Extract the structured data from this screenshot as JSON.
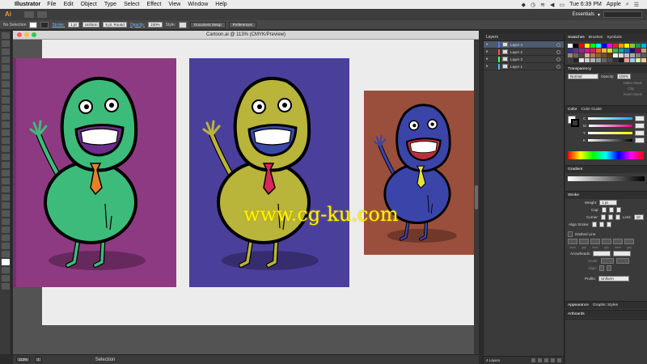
{
  "menubar": {
    "apple_glyph": "",
    "app_name": "Illustrator",
    "items": [
      "File",
      "Edit",
      "Object",
      "Type",
      "Select",
      "Effect",
      "View",
      "Window",
      "Help"
    ],
    "clock": "Tue 6:39 PM",
    "user": "Apple"
  },
  "appbar": {
    "logo": "Ai",
    "workspace": "Essentials"
  },
  "controlbar": {
    "selection_status": "No Selection",
    "stroke_label": "Stroke:",
    "stroke_weight": "1 pt",
    "profile": "Uniform",
    "brush": "5 pt. Round",
    "opacity_label": "Opacity:",
    "opacity_value": "100%",
    "style_label": "Style:",
    "doc_setup": "Document Setup",
    "preferences": "Preferences"
  },
  "document": {
    "tab_title": "Cartoon.ai @ 113% (CMYK/Preview)"
  },
  "statusbar": {
    "zoom": "113%",
    "page": "1",
    "tool": "Selection"
  },
  "layers_panel": {
    "title": "Layers",
    "layers": [
      {
        "name": "Layer 4",
        "color": "#4a7cff"
      },
      {
        "name": "Layer 2",
        "color": "#ff4a4a"
      },
      {
        "name": "Layer 3",
        "color": "#4aff5a"
      },
      {
        "name": "Layer 1",
        "color": "#4ab3ff"
      }
    ],
    "footer": "4 Layers"
  },
  "dock": {
    "swatch_tabs": [
      "Swatches",
      "Brushes",
      "Symbols"
    ],
    "transparency": {
      "title": "Transparency",
      "mode": "Normal",
      "opacity_label": "Opacity:",
      "opacity_value": "100%",
      "make_mask": "Make Mask",
      "clip": "Clip",
      "invert_mask": "Invert Mask"
    },
    "color": {
      "tabs": [
        "Color",
        "Color Guide"
      ],
      "channels": [
        "C",
        "M",
        "Y",
        "K"
      ]
    },
    "gradient": {
      "title": "Gradient"
    },
    "stroke": {
      "title": "Stroke",
      "weight_label": "Weight:",
      "weight_value": "1 pt",
      "cap_label": "Cap:",
      "corner_label": "Corner:",
      "limit_label": "Limit:",
      "limit_value": "10",
      "align_label": "Align Stroke:",
      "dashed_label": "Dashed Line",
      "dash_labels": [
        "dash",
        "gap",
        "dash",
        "gap",
        "dash",
        "gap"
      ],
      "arrowheads_label": "Arrowheads:",
      "scale_label": "Scale:",
      "align_arrow_label": "Align:",
      "profile_label": "Profile:",
      "profile_value": "Uniform"
    },
    "bottom_tabs": [
      "Appearance",
      "Graphic Styles"
    ],
    "artboards_tab": "Artboards"
  },
  "artwork": {
    "watermark": "www.cg-ku.com",
    "panels": [
      {
        "bg": "#8e3a82",
        "body": "#3dbb7a",
        "tie": "#e87f2a",
        "mouth": "#6b2e8a"
      },
      {
        "bg": "#4b3f9c",
        "body": "#b9b43a",
        "tie": "#d8255a",
        "mouth": "#3b4aa8"
      },
      {
        "bg": "#9a4e3c",
        "body": "#3b44a8",
        "tie": "#e6e33a",
        "mouth": "#b8313a"
      }
    ]
  },
  "colors": {
    "accent": "#f49a2b",
    "selection_blue": "#4d5a70",
    "link_blue": "#7fb2ff"
  }
}
